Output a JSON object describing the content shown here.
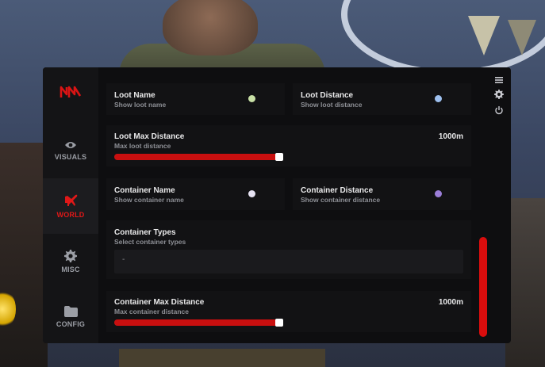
{
  "sidebar": {
    "logo": "brand-logo",
    "items": [
      {
        "label": "VISUALS",
        "icon": "eye-icon",
        "active": false
      },
      {
        "label": "WORLD",
        "icon": "airplane-icon",
        "active": true
      },
      {
        "label": "MISC",
        "icon": "gear-icon",
        "active": false
      },
      {
        "label": "CONFIG",
        "icon": "folder-icon",
        "active": false
      }
    ]
  },
  "settings": {
    "loot_name": {
      "title": "Loot Name",
      "subtitle": "Show loot name",
      "color": "#c8e0a6"
    },
    "loot_distance": {
      "title": "Loot Distance",
      "subtitle": "Show loot distance",
      "color": "#9ec0ef"
    },
    "loot_max_distance": {
      "title": "Loot Max Distance",
      "subtitle": "Max loot distance",
      "value": "1000m",
      "fraction": 1.0
    },
    "container_name": {
      "title": "Container Name",
      "subtitle": "Show container name",
      "color": "#e6e2f2"
    },
    "container_distance": {
      "title": "Container Distance",
      "subtitle": "Show container distance",
      "color": "#9b7ed8"
    },
    "container_types": {
      "title": "Container Types",
      "subtitle": "Select container types",
      "selected": "-"
    },
    "container_max_distance": {
      "title": "Container Max Distance",
      "subtitle": "Max container distance",
      "value": "1000m",
      "fraction": 1.0
    }
  },
  "rightbar": {
    "icons": [
      "menu-icon",
      "gear-icon",
      "power-icon"
    ]
  },
  "colors": {
    "accent": "#d90d0d",
    "panel": "#0e0e10"
  }
}
